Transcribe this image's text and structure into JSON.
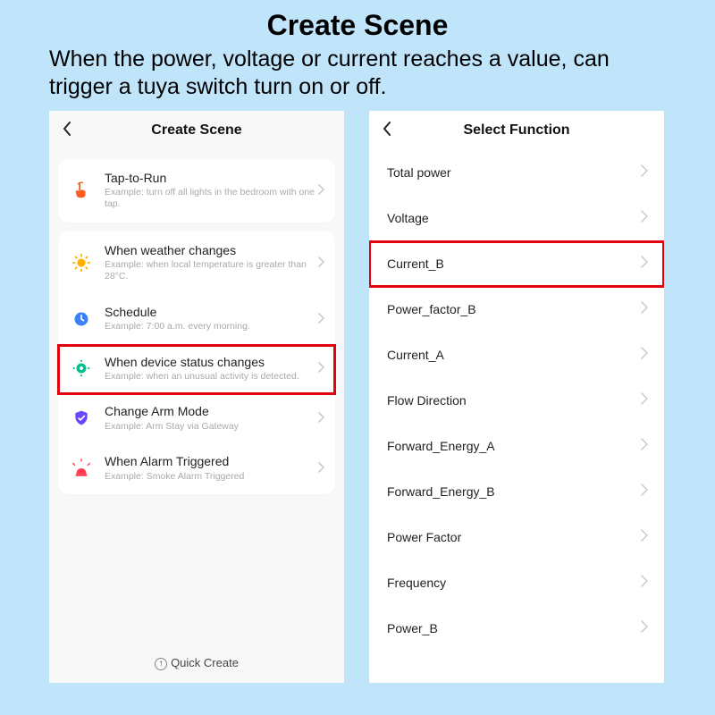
{
  "header": {
    "title": "Create Scene",
    "description": "When the power, voltage or current reaches a value, can trigger a tuya switch turn on or off."
  },
  "left_screen": {
    "title": "Create Scene",
    "tap_to_run": {
      "title": "Tap-to-Run",
      "subtitle": "Example: turn off all lights in the bedroom with one tap."
    },
    "conditions": [
      {
        "icon": "sun",
        "title": "When weather changes",
        "subtitle": "Example: when local temperature is greater than 28°C.",
        "highlight": false
      },
      {
        "icon": "clock",
        "title": "Schedule",
        "subtitle": "Example: 7:00 a.m. every morning.",
        "highlight": false
      },
      {
        "icon": "device",
        "title": "When device status changes",
        "subtitle": "Example: when an unusual activity is detected.",
        "highlight": true
      },
      {
        "icon": "shield",
        "title": "Change Arm Mode",
        "subtitle": "Example: Arm Stay via Gateway",
        "highlight": false
      },
      {
        "icon": "alarm",
        "title": "When Alarm Triggered",
        "subtitle": "Example: Smoke Alarm Triggered",
        "highlight": false
      }
    ],
    "quick_create": "Quick Create"
  },
  "right_screen": {
    "title": "Select Function",
    "functions": [
      {
        "label": "Total power",
        "highlight": false
      },
      {
        "label": "Voltage",
        "highlight": false
      },
      {
        "label": "Current_B",
        "highlight": true
      },
      {
        "label": "Power_factor_B",
        "highlight": false
      },
      {
        "label": "Current_A",
        "highlight": false
      },
      {
        "label": "Flow Direction",
        "highlight": false
      },
      {
        "label": "Forward_Energy_A",
        "highlight": false
      },
      {
        "label": "Forward_Energy_B",
        "highlight": false
      },
      {
        "label": "Power Factor",
        "highlight": false
      },
      {
        "label": "Frequency",
        "highlight": false
      },
      {
        "label": "Power_B",
        "highlight": false
      }
    ]
  }
}
